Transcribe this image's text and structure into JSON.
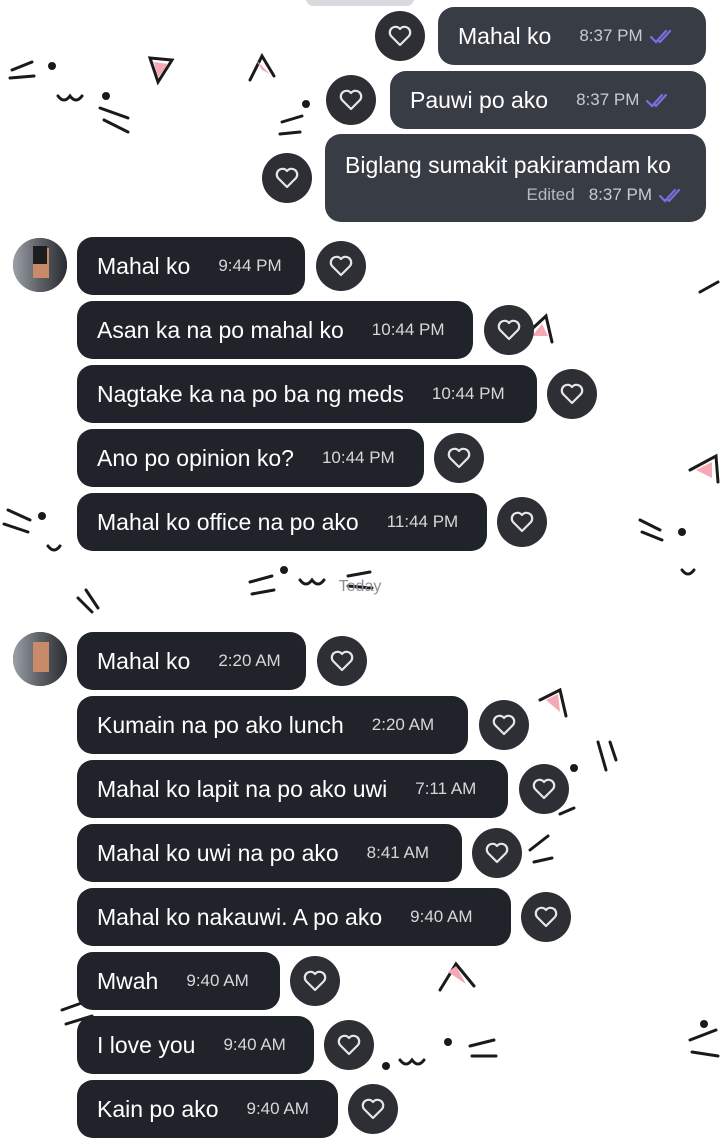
{
  "colors": {
    "incoming_bubble": "#21232a",
    "outgoing_bubble": "#383c45",
    "read_check": "#7a6fe0",
    "wallpaper_ear": "#f4a9b4"
  },
  "icons": {
    "reaction": "heart-outline-icon",
    "read_receipt": "double-check-icon"
  },
  "messages_outgoing": [
    {
      "text": "Mahal ko",
      "time": "8:37 PM"
    },
    {
      "text": "Pauwi po ako",
      "time": "8:37 PM"
    },
    {
      "text": "Biglang sumakit pakiramdam ko",
      "status": "Edited",
      "time": "8:37 PM"
    }
  ],
  "group_earlier": [
    {
      "text": "Mahal ko",
      "time": "9:44 PM"
    },
    {
      "text": "Asan ka na po mahal ko",
      "time": "10:44 PM"
    },
    {
      "text": "Nagtake ka na po ba ng meds",
      "time": "10:44 PM"
    },
    {
      "text": "Ano po opinion ko?",
      "time": "10:44 PM"
    },
    {
      "text": "Mahal ko office na po ako",
      "time": "11:44 PM"
    }
  ],
  "divider_label": "Today",
  "group_today": [
    {
      "text": "Mahal ko",
      "time": "2:20 AM"
    },
    {
      "text": "Kumain na po ako lunch",
      "time": "2:20 AM"
    },
    {
      "text": "Mahal ko lapit na po ako uwi",
      "time": "7:11 AM"
    },
    {
      "text": "Mahal ko uwi na po ako",
      "time": "8:41 AM"
    },
    {
      "text": "Mahal ko nakauwi. A po ako",
      "time": "9:40 AM"
    },
    {
      "text": "Mwah",
      "time": "9:40 AM"
    },
    {
      "text": "I love you",
      "time": "9:40 AM"
    },
    {
      "text": "Kain po ako",
      "time": "9:40 AM"
    }
  ]
}
